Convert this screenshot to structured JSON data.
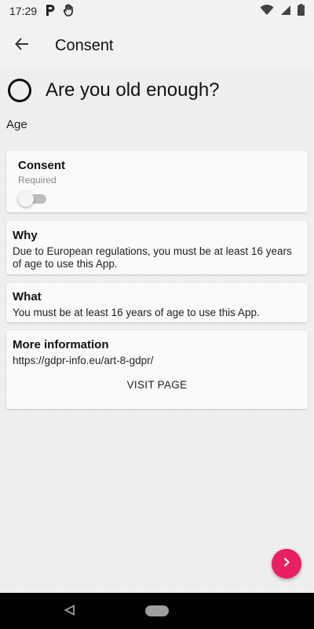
{
  "status_bar": {
    "time": "17:29",
    "icons": [
      "parking-p-icon",
      "hand-icon",
      "wifi-icon",
      "signal-icon",
      "battery-icon"
    ]
  },
  "app_bar": {
    "title": "Consent",
    "back_icon": "arrow-left-icon"
  },
  "question": {
    "title": "Are you old enough?",
    "subtitle": "Age"
  },
  "cards": {
    "consent": {
      "title": "Consent",
      "status": "Required",
      "toggle_on": false
    },
    "why": {
      "title": "Why",
      "text": "Due to European regulations, you must be at least 16 years of age to use this App."
    },
    "what": {
      "title": "What",
      "text": "You must be at least 16 years of age to use this App."
    },
    "more": {
      "title": "More information",
      "link": "https://gdpr-info.eu/art-8-gdpr/",
      "button": "VISIT PAGE"
    }
  },
  "fab": {
    "icon": "chevron-right-icon",
    "color": "#e91e63"
  },
  "nav_bar": {
    "icons": [
      "nav-back-icon",
      "nav-home-icon"
    ]
  }
}
